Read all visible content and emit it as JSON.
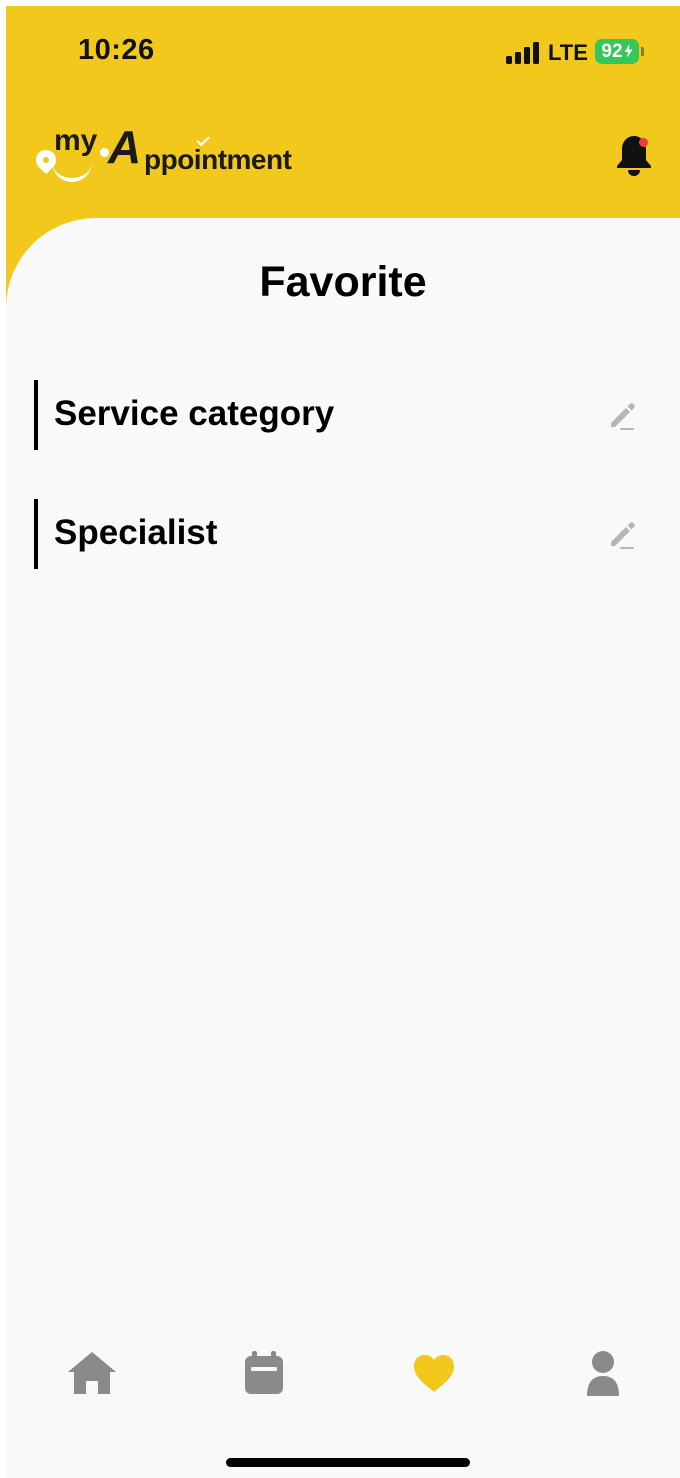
{
  "status_bar": {
    "time": "10:26",
    "network": "LTE",
    "battery": "92"
  },
  "header": {
    "logo_my": "my",
    "logo_a": "A",
    "logo_rest": "ppointment",
    "notification_badge": true
  },
  "page": {
    "title": "Favorite"
  },
  "favorites": [
    {
      "label": "Service category"
    },
    {
      "label": "Specialist"
    }
  ],
  "tab_bar": {
    "items": [
      {
        "icon": "home-icon",
        "active": false
      },
      {
        "icon": "calendar-icon",
        "active": false
      },
      {
        "icon": "heart-icon",
        "active": true
      },
      {
        "icon": "profile-icon",
        "active": false
      }
    ]
  },
  "colors": {
    "brand_yellow": "#f2c81d",
    "inactive_icon": "#8a8a8a",
    "edit_icon": "#b5b5b5",
    "notification_dot": "#ee3b3b",
    "battery_green": "#34c759"
  }
}
